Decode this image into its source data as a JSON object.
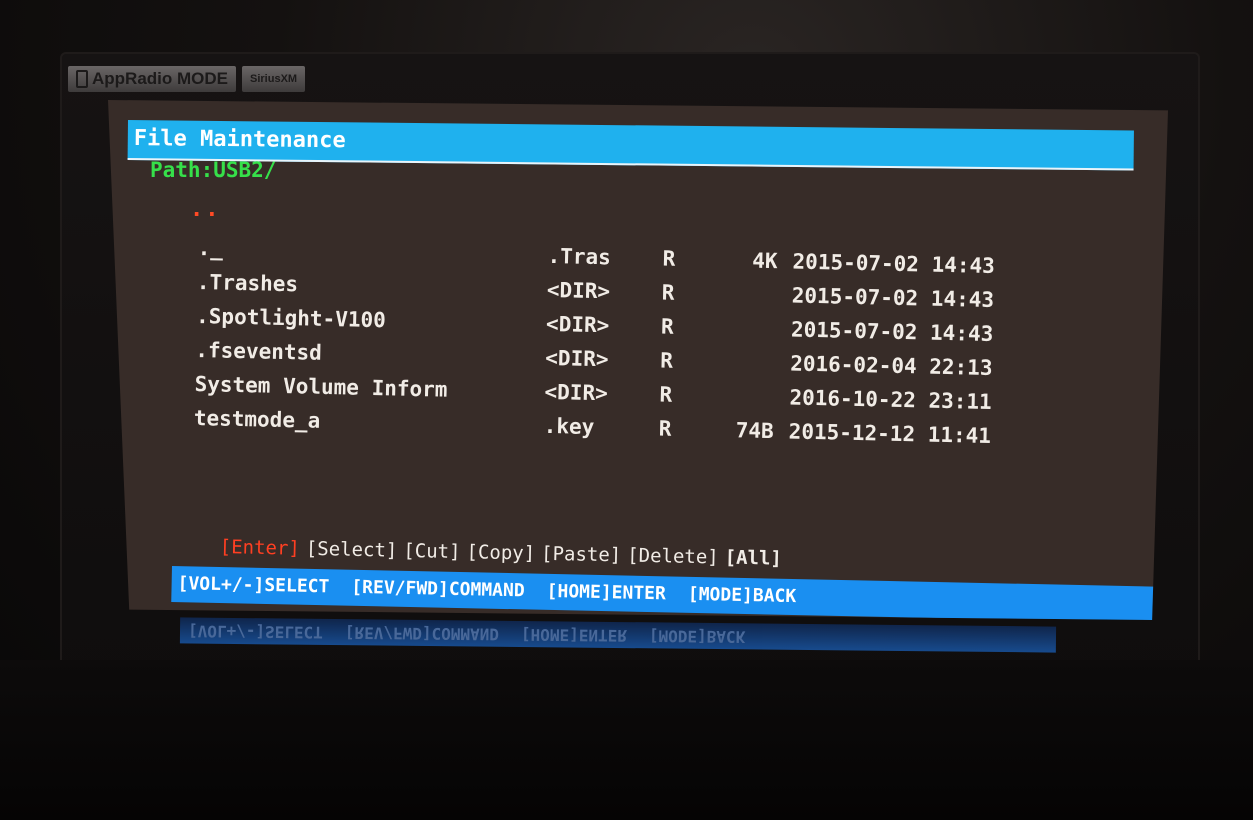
{
  "top_buttons": {
    "appradio": "AppRadio MODE",
    "siriusxm": "SiriusXM"
  },
  "window": {
    "title": "File Maintenance",
    "path": "Path:USB2/",
    "parent_dir": ".."
  },
  "files": [
    {
      "name": "._",
      "type": ".Tras",
      "attr": "R",
      "size": "4K",
      "date": "2015-07-02 14:43"
    },
    {
      "name": ".Trashes",
      "type": "<DIR>",
      "attr": "R",
      "size": "",
      "date": "2015-07-02 14:43"
    },
    {
      "name": ".Spotlight-V100",
      "type": "<DIR>",
      "attr": "R",
      "size": "",
      "date": "2015-07-02 14:43"
    },
    {
      "name": ".fseventsd",
      "type": "<DIR>",
      "attr": "R",
      "size": "",
      "date": "2016-02-04 22:13"
    },
    {
      "name": "System Volume Inform",
      "type": "<DIR>",
      "attr": "R",
      "size": "",
      "date": "2016-10-22 23:11"
    },
    {
      "name": "testmode_a",
      "type": ".key",
      "attr": "R",
      "size": "74B",
      "date": "2015-12-12 11:41"
    }
  ],
  "commands": {
    "enter": "[Enter]",
    "select": "[Select]",
    "cut": "[Cut]",
    "copy": "[Copy]",
    "paste": "[Paste]",
    "delete": "[Delete]",
    "all": "[All]"
  },
  "help": {
    "select": "[VOL+/-]SELECT",
    "command": "[REV/FWD]COMMAND",
    "enter": "[HOME]ENTER",
    "back": "[MODE]BACK"
  },
  "colors": {
    "title_bar": "#1fb1ee",
    "help_bar": "#1a8ff1",
    "path_text": "#36e04a",
    "highlight": "#ff3f22",
    "screen_bg": "#372c28"
  }
}
